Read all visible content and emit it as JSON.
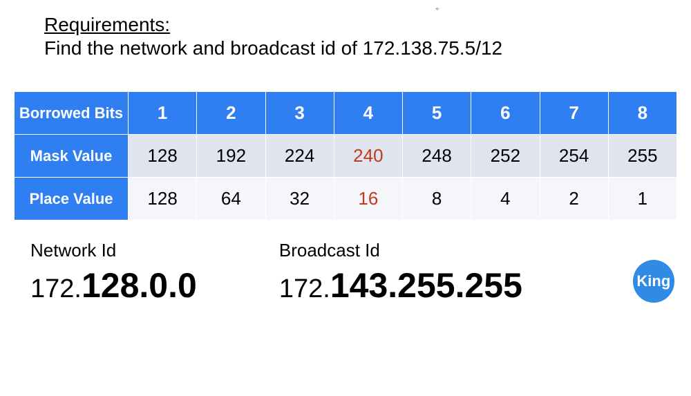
{
  "requirements": {
    "title": "Requirements:",
    "text": "Find the network and broadcast id of 172.138.75.5/12"
  },
  "table": {
    "row_headers": {
      "bits": "Borrowed Bits",
      "mask": "Mask Value",
      "place": "Place Value"
    },
    "highlight_col": 3,
    "bits": [
      "1",
      "2",
      "3",
      "4",
      "5",
      "6",
      "7",
      "8"
    ],
    "mask": [
      "128",
      "192",
      "224",
      "240",
      "248",
      "252",
      "254",
      "255"
    ],
    "place": [
      "128",
      "64",
      "32",
      "16",
      "8",
      "4",
      "2",
      "1"
    ]
  },
  "answers": {
    "network": {
      "label": "Network Id",
      "prefix": "172.",
      "rest": "128.0.0"
    },
    "broadcast": {
      "label": "Broadcast Id",
      "prefix": "172.",
      "rest": "143.255.255"
    }
  },
  "badge": "King"
}
